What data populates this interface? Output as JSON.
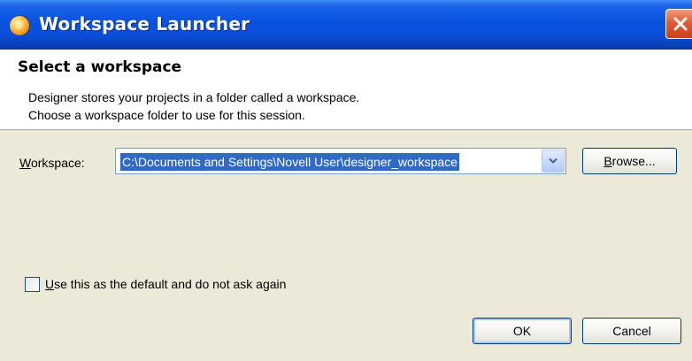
{
  "window": {
    "title": "Workspace Launcher"
  },
  "header": {
    "title": "Select a workspace",
    "description_line1": "Designer stores your projects in a folder called a workspace.",
    "description_line2": "Choose a workspace folder to use for this session."
  },
  "workspace": {
    "label_mnemonic": "W",
    "label_rest": "orkspace:",
    "value": "C:\\Documents and Settings\\Novell User\\designer_workspace",
    "browse_mnemonic": "B",
    "browse_rest": "rowse..."
  },
  "default_option": {
    "checked": false,
    "label_mnemonic": "U",
    "label_rest": "se this as the default and do not ask again"
  },
  "buttons": {
    "ok": "OK",
    "cancel": "Cancel"
  },
  "icons": {
    "app": "eclipse-orb-icon",
    "close": "close-x-icon",
    "dropdown": "chevron-down-icon"
  },
  "colors": {
    "titlebar": "#0a54e0",
    "close_button": "#e15c36",
    "selection": "#316ac5",
    "dialog_bg": "#ece9d8"
  }
}
